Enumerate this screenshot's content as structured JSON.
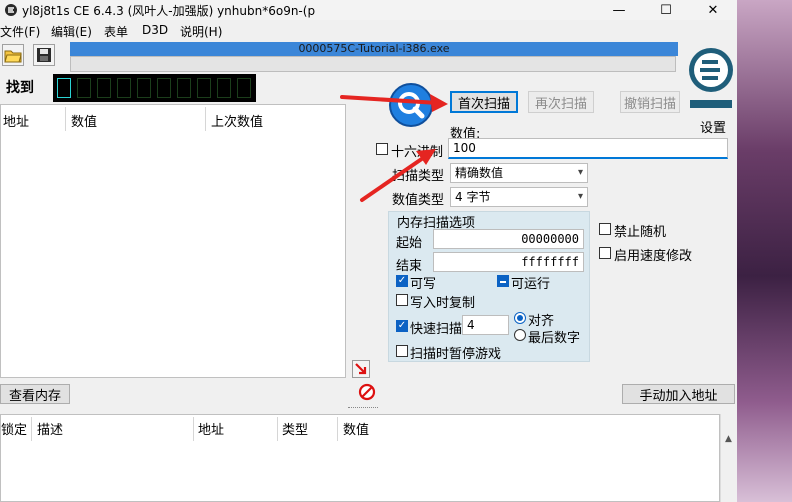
{
  "window": {
    "title": "yl8j8t1s  CE 6.4.3 (风叶人-加强版)  ynhubn*6o9n-(p",
    "controls": [
      "—",
      "☐",
      "✕"
    ]
  },
  "menu": [
    "文件(F)",
    "编辑(E)",
    "表单",
    "D3D",
    "说明(H)"
  ],
  "process": {
    "name": "0000575C-Tutorial-i386.exe"
  },
  "found": {
    "label": "找到"
  },
  "results": {
    "columns": [
      "地址",
      "数值",
      "上次数值"
    ]
  },
  "scan": {
    "first_scan": "首次扫描",
    "next_scan": "再次扫描",
    "undo_scan": "撤销扫描",
    "settings": "设置",
    "value_label": "数值:",
    "value": "100",
    "hex_label": "十六进制",
    "scan_type_label": "扫描类型",
    "scan_type_value": "精确数值",
    "value_type_label": "数值类型",
    "value_type_value": "4 字节"
  },
  "memory_options": {
    "title": "内存扫描选项",
    "start_label": "起始",
    "start_value": "00000000",
    "stop_label": "结束",
    "stop_value": "ffffffff",
    "writable": "可写",
    "executable": "可运行",
    "copy_on_write": "写入时复制",
    "fast_scan": "快速扫描",
    "fast_scan_value": "4",
    "alignment": "对齐",
    "last_digits": "最后数字",
    "pause_game": "扫描时暂停游戏"
  },
  "options": {
    "disable_random": "禁止随机",
    "enable_speedhack": "启用速度修改"
  },
  "buttons": {
    "memory_view": "查看内存",
    "add_address": "手动加入地址"
  },
  "address_list": {
    "columns": [
      "锁定",
      "描述",
      "地址",
      "类型",
      "数值"
    ]
  },
  "colors": {
    "accent": "#0078d7",
    "process_bar": "#3b86d8",
    "arrow": "#e52521",
    "group_bg": "#dbe9f0"
  }
}
